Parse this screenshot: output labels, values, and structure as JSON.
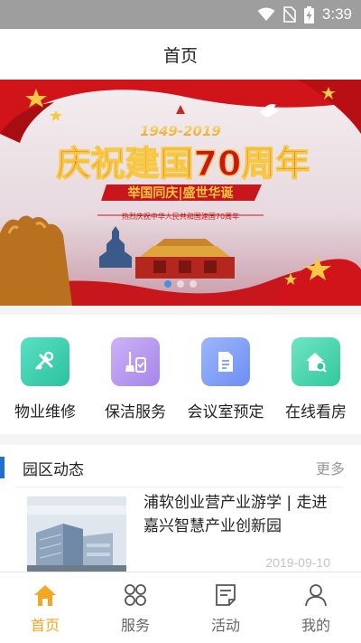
{
  "status_bar": {
    "time": "3:39",
    "icons": [
      "wifi-icon",
      "no-sim-icon",
      "battery-charging-icon"
    ]
  },
  "header": {
    "title": "首页"
  },
  "banner": {
    "years": "1949-2019",
    "headline": "庆祝建国70周年",
    "subhead": "举国同庆|盛世华诞",
    "tagline": "热烈庆祝中华人民共和国建国70周年",
    "slide_count": 3,
    "active_slide": 0,
    "colors": {
      "red": "#d0141a",
      "gold": "#f7c844"
    }
  },
  "services": [
    {
      "label": "物业维修",
      "icon": "tools-icon",
      "color": "#3ccfb0"
    },
    {
      "label": "保洁服务",
      "icon": "cleaning-icon",
      "color": "#b89cf0"
    },
    {
      "label": "会议室预定",
      "icon": "document-icon",
      "color": "#7a9cf5"
    },
    {
      "label": "在线看房",
      "icon": "house-search-icon",
      "color": "#40d3a8"
    }
  ],
  "news": {
    "section_title": "园区动态",
    "more_label": "更多",
    "items": [
      {
        "title": "浦软创业营产业游学 | 走进嘉兴智慧产业创新园",
        "date": "2019-09-10"
      }
    ]
  },
  "tabbar": {
    "items": [
      {
        "label": "首页",
        "icon": "home-icon",
        "active": true
      },
      {
        "label": "服务",
        "icon": "grid-icon",
        "active": false
      },
      {
        "label": "活动",
        "icon": "activity-icon",
        "active": false
      },
      {
        "label": "我的",
        "icon": "user-icon",
        "active": false
      }
    ],
    "active_color": "#f5a623"
  }
}
